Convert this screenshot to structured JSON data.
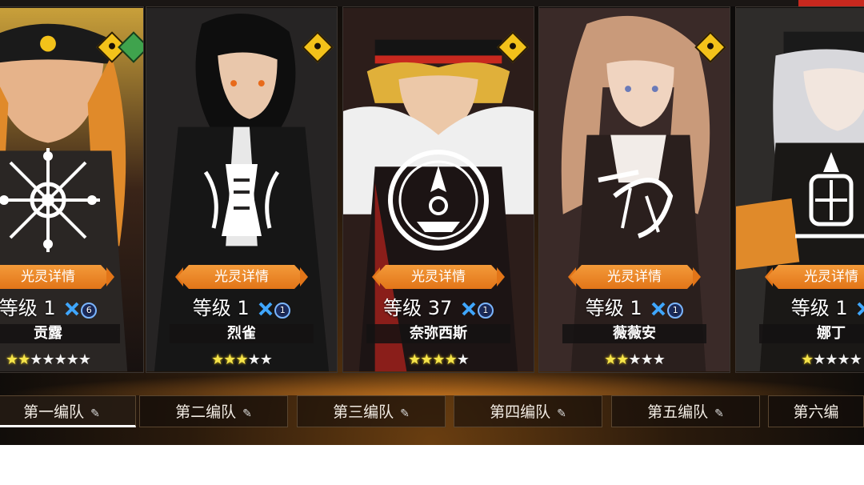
{
  "colors": {
    "accent_orange": "#e27518",
    "star_on": "#f6e54a",
    "star_off": "#f1f1f1",
    "x_blue": "#3fa6ff",
    "badge_yellow": "#f3c21a"
  },
  "detail_label": "光灵详情",
  "level_prefix": "等级",
  "cards": [
    {
      "name": "贡露",
      "level": "1",
      "gem": "6",
      "stars_on": 2,
      "stars_total": 7,
      "bg": "#5a3a20",
      "hair": "#e89a2a"
    },
    {
      "name": "烈雀",
      "level": "1",
      "gem": "1",
      "stars_on": 3,
      "stars_total": 5,
      "bg": "#2c2a2a",
      "hair": "#111111"
    },
    {
      "name": "奈弥西斯",
      "level": "37",
      "gem": "1",
      "stars_on": 4,
      "stars_total": 5,
      "bg": "#3a2622",
      "hair": "#d9a43a"
    },
    {
      "name": "薇薇安",
      "level": "1",
      "gem": "1",
      "stars_on": 2,
      "stars_total": 5,
      "bg": "#4a3230",
      "hair": "#c99a7a"
    },
    {
      "name": "娜丁",
      "level": "1",
      "gem": "",
      "stars_on": 1,
      "stars_total": 5,
      "bg": "#3a3836",
      "hair": "#d8d8dc"
    }
  ],
  "tabs": [
    {
      "label": "第一编队",
      "active": true
    },
    {
      "label": "第二编队",
      "active": false
    },
    {
      "label": "第三编队",
      "active": false
    },
    {
      "label": "第四编队",
      "active": false
    },
    {
      "label": "第五编队",
      "active": false
    },
    {
      "label": "第六编",
      "active": false
    }
  ]
}
